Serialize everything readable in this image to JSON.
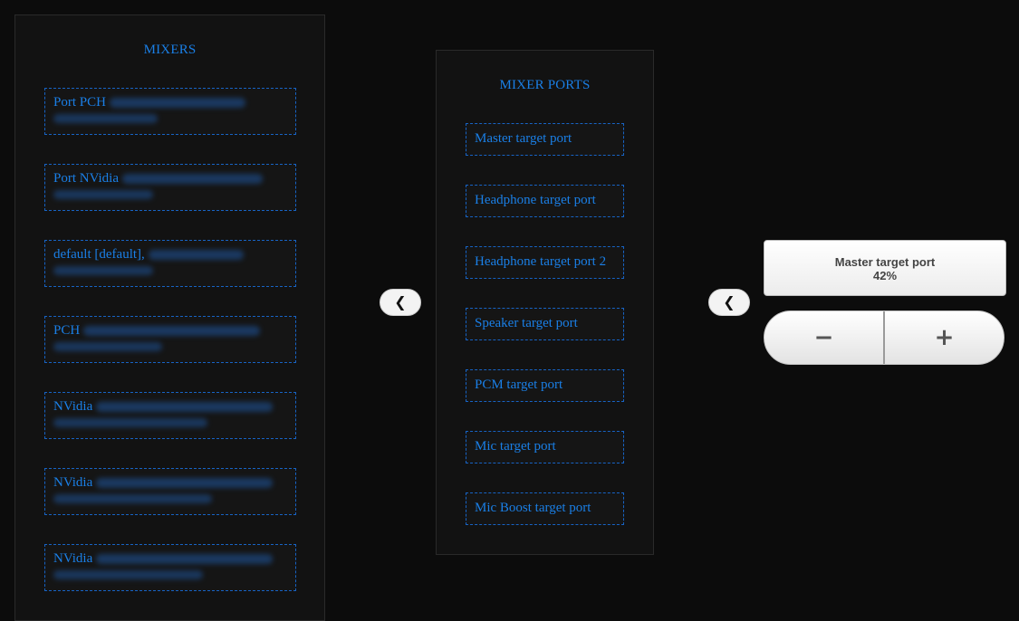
{
  "mixers": {
    "title": "MIXERS",
    "items": [
      {
        "label": "Port PCH"
      },
      {
        "label": "Port NVidia"
      },
      {
        "label": "default [default],"
      },
      {
        "label": "PCH"
      },
      {
        "label": "NVidia"
      },
      {
        "label": "NVidia"
      },
      {
        "label": "NVidia"
      }
    ]
  },
  "ports": {
    "title": "MIXER PORTS",
    "items": [
      {
        "label": "Master target port"
      },
      {
        "label": "Headphone target port"
      },
      {
        "label": "Headphone target port 2"
      },
      {
        "label": "Speaker target port"
      },
      {
        "label": "PCM target port"
      },
      {
        "label": "Mic target port"
      },
      {
        "label": "Mic Boost target port"
      }
    ]
  },
  "nav": {
    "back_icon": "chevron-left-icon",
    "back_glyph": "❮"
  },
  "volume": {
    "port_name": "Master target port",
    "level": "42%",
    "minus_label": "−",
    "plus_label": "+"
  },
  "colors": {
    "accent": "#1a7fe6",
    "background": "#0c0c0c",
    "panel": "#121212"
  }
}
